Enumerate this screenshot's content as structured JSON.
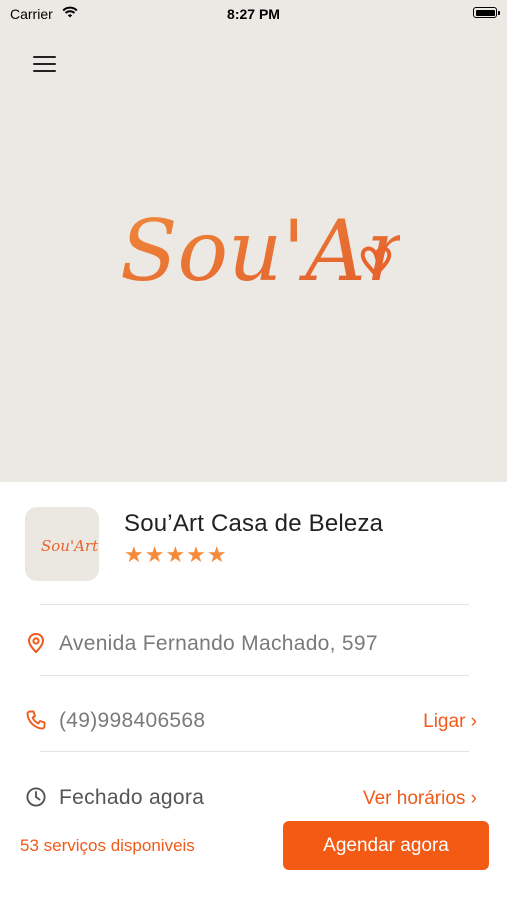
{
  "status_bar": {
    "carrier": "Carrier",
    "time": "8:27 PM"
  },
  "hero": {
    "logo_text": "Sou'Art"
  },
  "business": {
    "logo_text": "Sou'Art",
    "name": "Sou’Art Casa de Beleza",
    "rating": 5,
    "stars": "★★★★★"
  },
  "address": {
    "text": "Avenida Fernando Machado, 597"
  },
  "phone": {
    "text": "(49)998406568",
    "action_label": "Ligar ›"
  },
  "hours": {
    "text": "Fechado agora",
    "action_label": "Ver horários ›"
  },
  "footer": {
    "services_label": "53 serviços disponiveis",
    "book_button": "Agendar agora"
  },
  "colors": {
    "accent": "#f35a14",
    "hero_bg": "#ece8e3",
    "star": "#f58a3a"
  }
}
